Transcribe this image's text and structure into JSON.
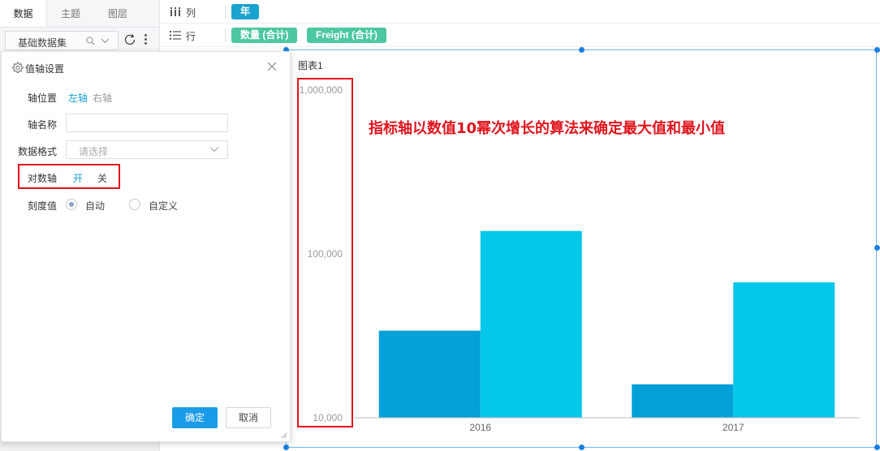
{
  "left_panel": {
    "tabs": [
      {
        "label": "数据",
        "active": true
      },
      {
        "label": "主题",
        "active": false
      },
      {
        "label": "图层",
        "active": false
      }
    ],
    "dataset": {
      "label": "基础数据集"
    }
  },
  "shelf": {
    "columns": {
      "label": "列",
      "fields": [
        "年"
      ]
    },
    "rows": {
      "label": "行",
      "fields": [
        "数量 (合计)",
        "Freight (合计)"
      ]
    }
  },
  "dialog": {
    "title": "值轴设置",
    "axis_position": {
      "label": "轴位置",
      "options": [
        "左轴",
        "右轴"
      ],
      "selected": "左轴"
    },
    "axis_name": {
      "label": "轴名称",
      "value": ""
    },
    "data_format": {
      "label": "数据格式",
      "placeholder": "请选择"
    },
    "log_axis": {
      "label": "对数轴",
      "options": [
        "开",
        "关"
      ],
      "selected": "开"
    },
    "tick": {
      "label": "刻度值",
      "options": [
        "自动",
        "自定义"
      ],
      "selected": "自动"
    },
    "confirm_label": "确定",
    "cancel_label": "取消"
  },
  "chart": {
    "title": "图表1",
    "annotation": "指标轴以数值10幂次增长的算法来确定最大值和最小值"
  },
  "colors": {
    "accent": "#1a9fd0",
    "series_1": "#039fd8",
    "series_2": "#04c7e9",
    "pill_column": "#1aa3cf",
    "pill_row": "#4cc7a2",
    "highlight_red": "#e0141c"
  },
  "chart_data": {
    "type": "bar",
    "categories": [
      "2016",
      "2017"
    ],
    "series": [
      {
        "values": [
          34000,
          16000
        ]
      },
      {
        "values": [
          138000,
          67000
        ]
      }
    ],
    "yscale": "log",
    "ylim": [
      10000,
      1000000
    ],
    "yticks": [
      10000,
      100000,
      1000000
    ],
    "ytick_labels": [
      "10,000",
      "100,000",
      "1,000,000"
    ],
    "grid": false,
    "legend": "none"
  }
}
